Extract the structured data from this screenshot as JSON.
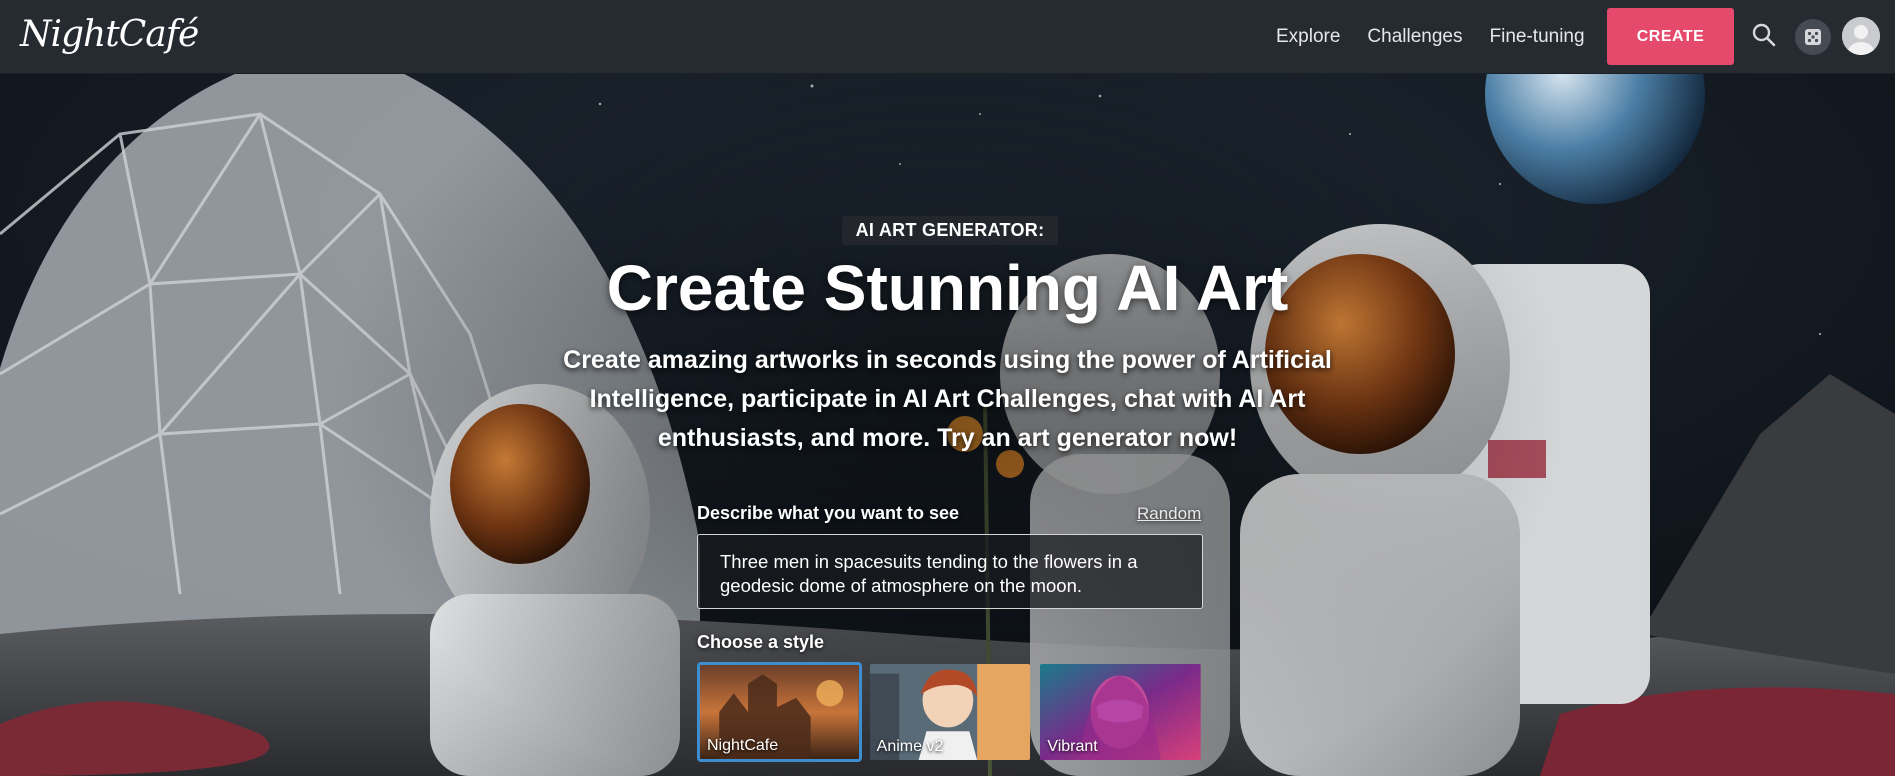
{
  "brand": {
    "logo_text": "NightCafé"
  },
  "nav": {
    "links": [
      "Explore",
      "Challenges",
      "Fine-tuning"
    ],
    "create_label": "CREATE"
  },
  "hero": {
    "eyebrow": "AI ART GENERATOR:",
    "headline": "Create Stunning AI Art",
    "subtext": "Create amazing artworks in seconds using the power of Artificial Intelligence, participate in AI Art Challenges, chat with AI Art enthusiasts, and more. Try an art generator now!",
    "prompt_label": "Describe what you want to see",
    "random_label": "Random",
    "prompt_value": "Three men in spacesuits tending to the flowers in a geodesic dome of atmosphere on the moon.",
    "style_label": "Choose a style",
    "styles": [
      {
        "name": "NightCafe",
        "selected": true
      },
      {
        "name": "Anime v2",
        "selected": false
      },
      {
        "name": "Vibrant",
        "selected": false
      }
    ]
  },
  "colors": {
    "accent": "#e5496c",
    "header_bg": "#262a31",
    "selected_border": "#3d8ed0"
  },
  "icons": [
    "search-icon",
    "dice-icon",
    "user-avatar-icon"
  ]
}
